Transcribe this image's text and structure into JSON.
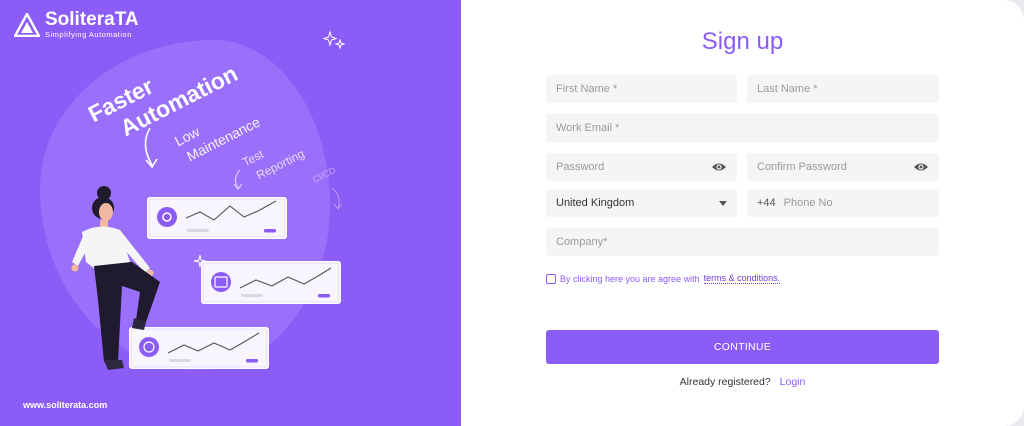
{
  "brand": {
    "name": "SoliteraTA",
    "tagline": "Simplifying Automation",
    "website": "www.soliterata.com"
  },
  "illustration": {
    "headline_line1": "Faster",
    "headline_line2": "Automation",
    "label_low": "Low",
    "label_maintenance": "Maintenance",
    "label_test": "Test",
    "label_reporting": "Reporting",
    "label_cicd": "CI/CD"
  },
  "form": {
    "title": "Sign up",
    "first_name_placeholder": "First Name *",
    "last_name_placeholder": "Last Name *",
    "email_placeholder": "Work Email *",
    "password_placeholder": "Password",
    "confirm_password_placeholder": "Confirm Password",
    "country_value": "United Kingdom",
    "phone_prefix": "+44",
    "phone_placeholder": "Phone No",
    "company_placeholder": "Company*",
    "agree_text": "By clicking here you are agree with",
    "terms_link": "terms & conditions.",
    "continue_label": "CONTINUE",
    "already_registered": "Already registered?",
    "login_link": "Login"
  },
  "colors": {
    "brand_purple": "#8b5cf6",
    "field_bg": "#f5f5f5"
  },
  "icons": [
    "eye-icon",
    "chevron-down-icon",
    "checkbox-icon",
    "sparkle-icon",
    "arrow-icon",
    "brand-logo-icon"
  ]
}
